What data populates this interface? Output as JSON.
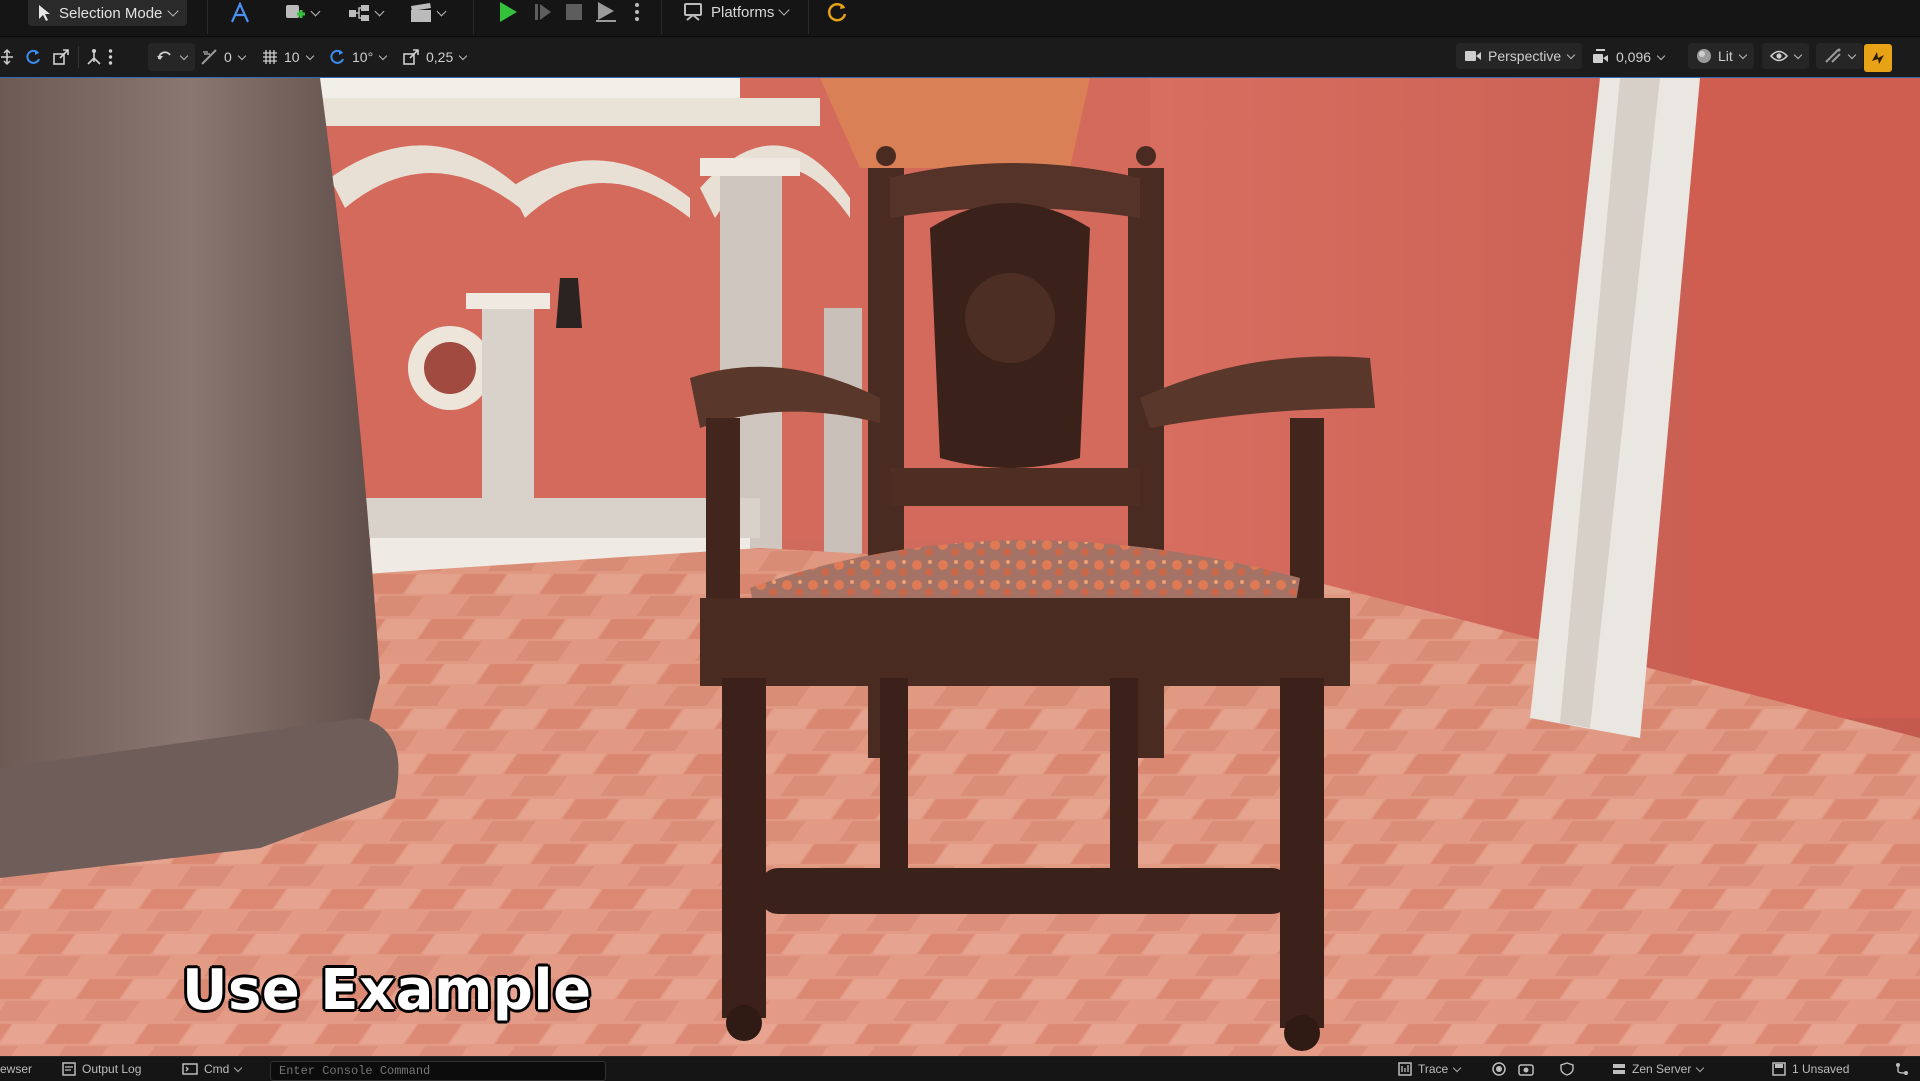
{
  "main_toolbar": {
    "selection_mode_label": "Selection Mode",
    "platforms_label": "Platforms",
    "icons": [
      "selection-cursor-icon",
      "modeling-mode-icon",
      "add-actor-icon",
      "blueprint-icon",
      "cinematics-icon",
      "play-icon",
      "advance-frame-icon",
      "stop-icon",
      "play-options-icon",
      "more-options-icon",
      "platforms-icon",
      "compile-status-icon"
    ],
    "colors": {
      "play": "#34c03c",
      "accent": "#e8a215",
      "background": "#151515"
    }
  },
  "viewport_toolbar": {
    "translate_snap_value": "0",
    "grid_snap_value": "10",
    "rotation_snap_value": "10°",
    "scale_snap_value": "0,25",
    "perspective_label": "Perspective",
    "camera_speed_value": "0,096",
    "view_mode_label": "Lit"
  },
  "viewport": {
    "overlay_caption": "Use Example",
    "scene": "ornate wooden armchair with floral fabric seat in a terracotta courtyard"
  },
  "status_bar": {
    "content_browser_label": "ewser",
    "output_log_label": "Output Log",
    "cmd_label": "Cmd",
    "console_placeholder": "Enter Console Command",
    "trace_label": "Trace",
    "zen_server_label": "Zen Server",
    "unsaved_label": "1 Unsaved"
  }
}
